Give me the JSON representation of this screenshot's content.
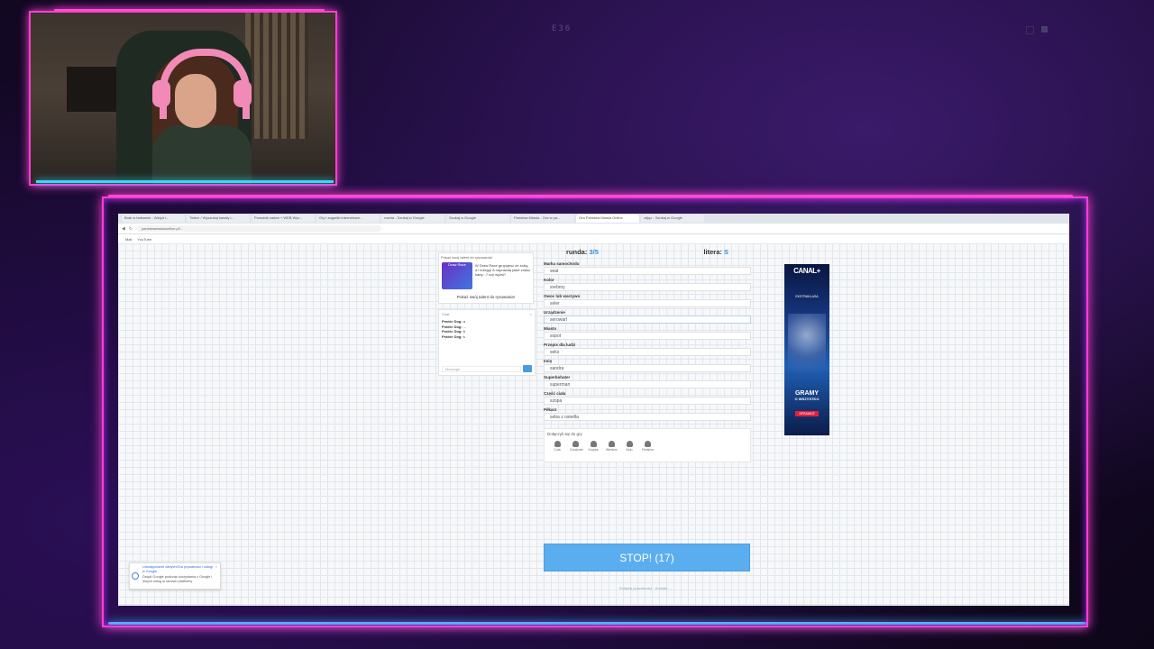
{
  "overlay": {
    "scene_label": "E36"
  },
  "browser": {
    "tabs": [
      "Brak w balsamie - Wstyd i...",
      "Twitch / Wyszukaj kanały i...",
      "Poradnik zadań + WEB.Wyc...",
      "Gry i zagadki internetowe...",
      "rozeta - Szukaj w Google",
      "Szukaj w Google",
      "Państwa Miasta - Gra w pa...",
      "Gra Państwa Miasta Online",
      "zdjęc - Szukaj w Google"
    ],
    "url": "panstwamiastaonline.pl/...",
    "bookmarks": [
      "Mail",
      "YouTube"
    ]
  },
  "promo": {
    "header": "Pokaż swój talent do rysowania!",
    "image_label": "Draw Race",
    "text": "W Draw Race grupujesz ze sobą, a i kolegą! A naprawdę jakie znasz karty...? czy wyżsi?",
    "link": "Pokaż swój talent do rysowania!"
  },
  "chat": {
    "title": "Chat",
    "messages": [
      {
        "user": "Prairie Dog:",
        "text": "a"
      },
      {
        "user": "Prairie Dog:",
        "text": "..."
      },
      {
        "user": "Prairie Dog:",
        "text": "b"
      },
      {
        "user": "Prairie Dog:",
        "text": "s"
      }
    ],
    "placeholder": "Message"
  },
  "game": {
    "round_label": "runda:",
    "round_value": "3/5",
    "letter_label": "litera:",
    "letter_value": "S",
    "fields": [
      {
        "label": "Marka samochodu",
        "value": "seat"
      },
      {
        "label": "Kolor",
        "value": "srebrny"
      },
      {
        "label": "Owoc lub warzywo",
        "value": "seler"
      },
      {
        "label": "Urządzenie",
        "value": "serowarl"
      },
      {
        "label": "Miasto",
        "value": "sopot"
      },
      {
        "label": "Przepis dla ludzi",
        "value": "seks"
      },
      {
        "label": "Imię",
        "value": "sandra"
      },
      {
        "label": "Superbohater",
        "value": "superman"
      },
      {
        "label": "Część ciała",
        "value": "szopa"
      },
      {
        "label": "Piłkarz",
        "value": "seba z osiedla"
      }
    ],
    "join_title": "Dołączyli się do gry",
    "players": [
      "Cola",
      "Gordonet",
      "Kropka",
      "Wiedźm",
      "Dziu",
      "Fiedzion"
    ],
    "stop_label": "STOP! (17)",
    "footer": "Polityka prywatności · Kontakt"
  },
  "ad": {
    "brand": "CANAL+",
    "sub": "EKSTRAKLASA",
    "headline_1": "GRAMY",
    "headline_2": "O WSZYSTKO",
    "cta": "SPRAWDŹ"
  },
  "notice": {
    "title": "Udostępnianie danych/Gra prywatność i usługi w Google",
    "body": "Dzięki Google podczas korzystania z Google i innych usług w ramach platformy",
    "close": "×"
  }
}
